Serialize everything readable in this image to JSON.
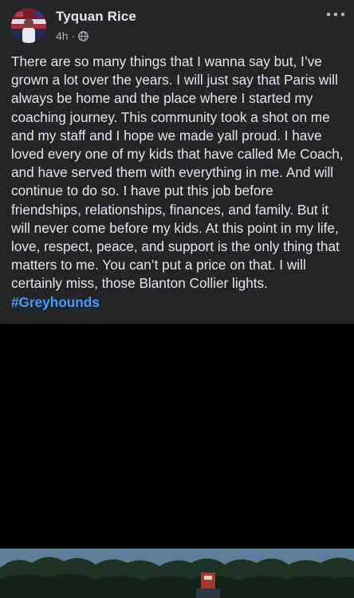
{
  "post": {
    "author": "Tyquan Rice",
    "timestamp": "4h",
    "meta_separator": "·",
    "audience_icon": "globe-icon",
    "more_icon": "more-horizontal-icon",
    "body": "There are so many things that I wanna say but, I’ve grown a lot over the years. I will just say that Paris will always be home and the place where I started my coaching journey. This community took a shot on me and my staff and I hope we made yall proud. I have loved every one of my kids that have called Me Coach, and have served them with everything in me. And will continue to do so. I have put this job before friendships, relationships, finances, and family. But it will never come before my kids. At this point in my life, love, respect, peace, and support is the only thing that matters to me. You can’t put a price on that. I will certainly miss, those Blanton Collier lights.",
    "hashtag": "#Greyhounds"
  },
  "colors": {
    "background": "#242526",
    "text": "#e4e6eb",
    "secondary_text": "#b0b3b8",
    "link": "#4599ff",
    "media_background": "#000000"
  }
}
